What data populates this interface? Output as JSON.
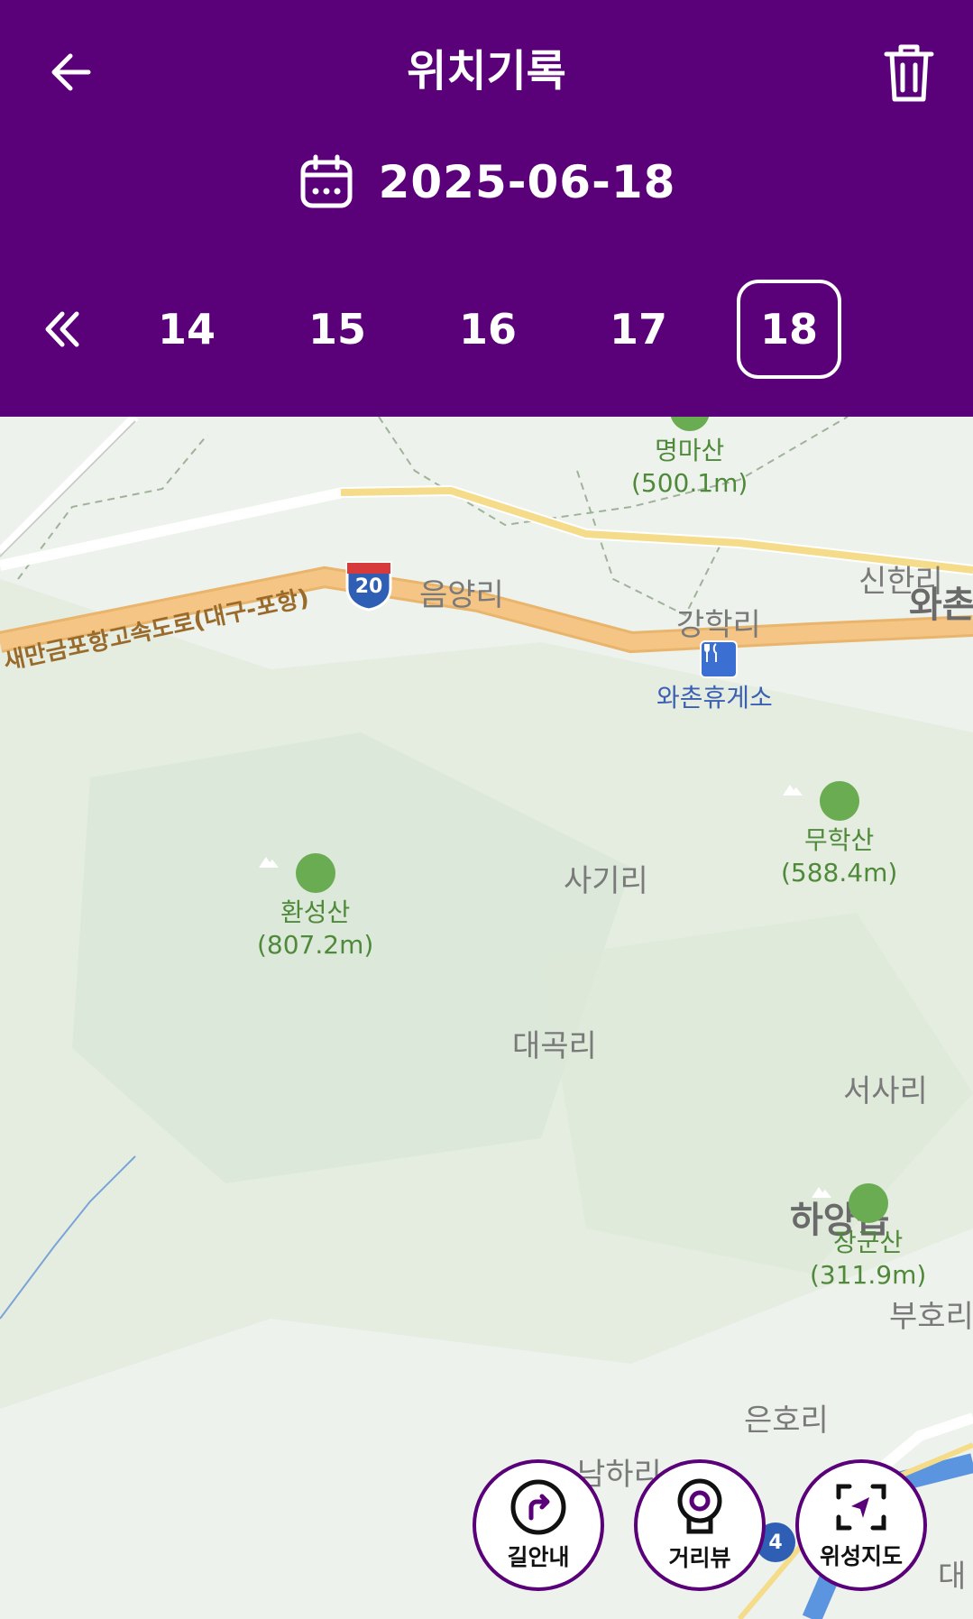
{
  "header": {
    "title": "위치기록",
    "date": "2025-06-18"
  },
  "day_tabs": [
    {
      "label": "14"
    },
    {
      "label": "15"
    },
    {
      "label": "16"
    },
    {
      "label": "17"
    },
    {
      "label": "18",
      "selected": true
    }
  ],
  "map": {
    "places": [
      "음양리",
      "강학리",
      "신한리",
      "사기리",
      "대곡리",
      "서사리",
      "하양읍",
      "부호리",
      "은호리",
      "남하리"
    ],
    "peaks": [
      {
        "name": "명마산",
        "height": "(500.1m)"
      },
      {
        "name": "무학산",
        "height": "(588.4m)"
      },
      {
        "name": "환성산",
        "height": "(807.2m)"
      },
      {
        "name": "장군산",
        "height": "(311.9m)"
      }
    ],
    "rest_area": "와촌휴게소",
    "highway_name": "새만금포항고속도로(대구-포항)",
    "highway_number": "20",
    "edge_labels": [
      "와촌",
      "대",
      "4"
    ]
  },
  "buttons": {
    "directions": "길안내",
    "street_view": "거리뷰",
    "satellite": "위성지도"
  },
  "colors": {
    "header_bg": "#5a0079",
    "highway": "#f2c27a",
    "peak_icon": "#6aac52"
  }
}
